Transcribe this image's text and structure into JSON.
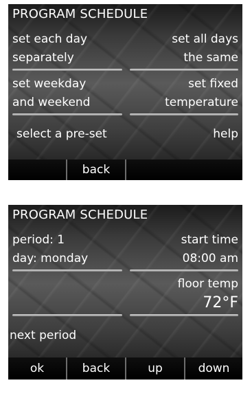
{
  "screen1": {
    "title": "PROGRAM SCHEDULE",
    "options": {
      "set_each_day": [
        "set each day",
        "separately"
      ],
      "set_all_days": [
        "set all days",
        "the same"
      ],
      "set_weekday": [
        "set weekday",
        "and weekend"
      ],
      "set_fixed": [
        "set fixed",
        "temperature"
      ],
      "select_preset": "select a pre-set",
      "help": "help"
    },
    "softkeys": {
      "key2": "back"
    }
  },
  "screen2": {
    "title": "PROGRAM SCHEDULE",
    "period_label": "period: 1",
    "day_label": "day: monday",
    "start_time_label": "start time",
    "start_time_value": "08:00 am",
    "floor_temp_label": "floor temp",
    "floor_temp_value": "72°F",
    "next_period": "next period",
    "softkeys": {
      "ok": "ok",
      "back": "back",
      "up": "up",
      "down": "down"
    }
  }
}
